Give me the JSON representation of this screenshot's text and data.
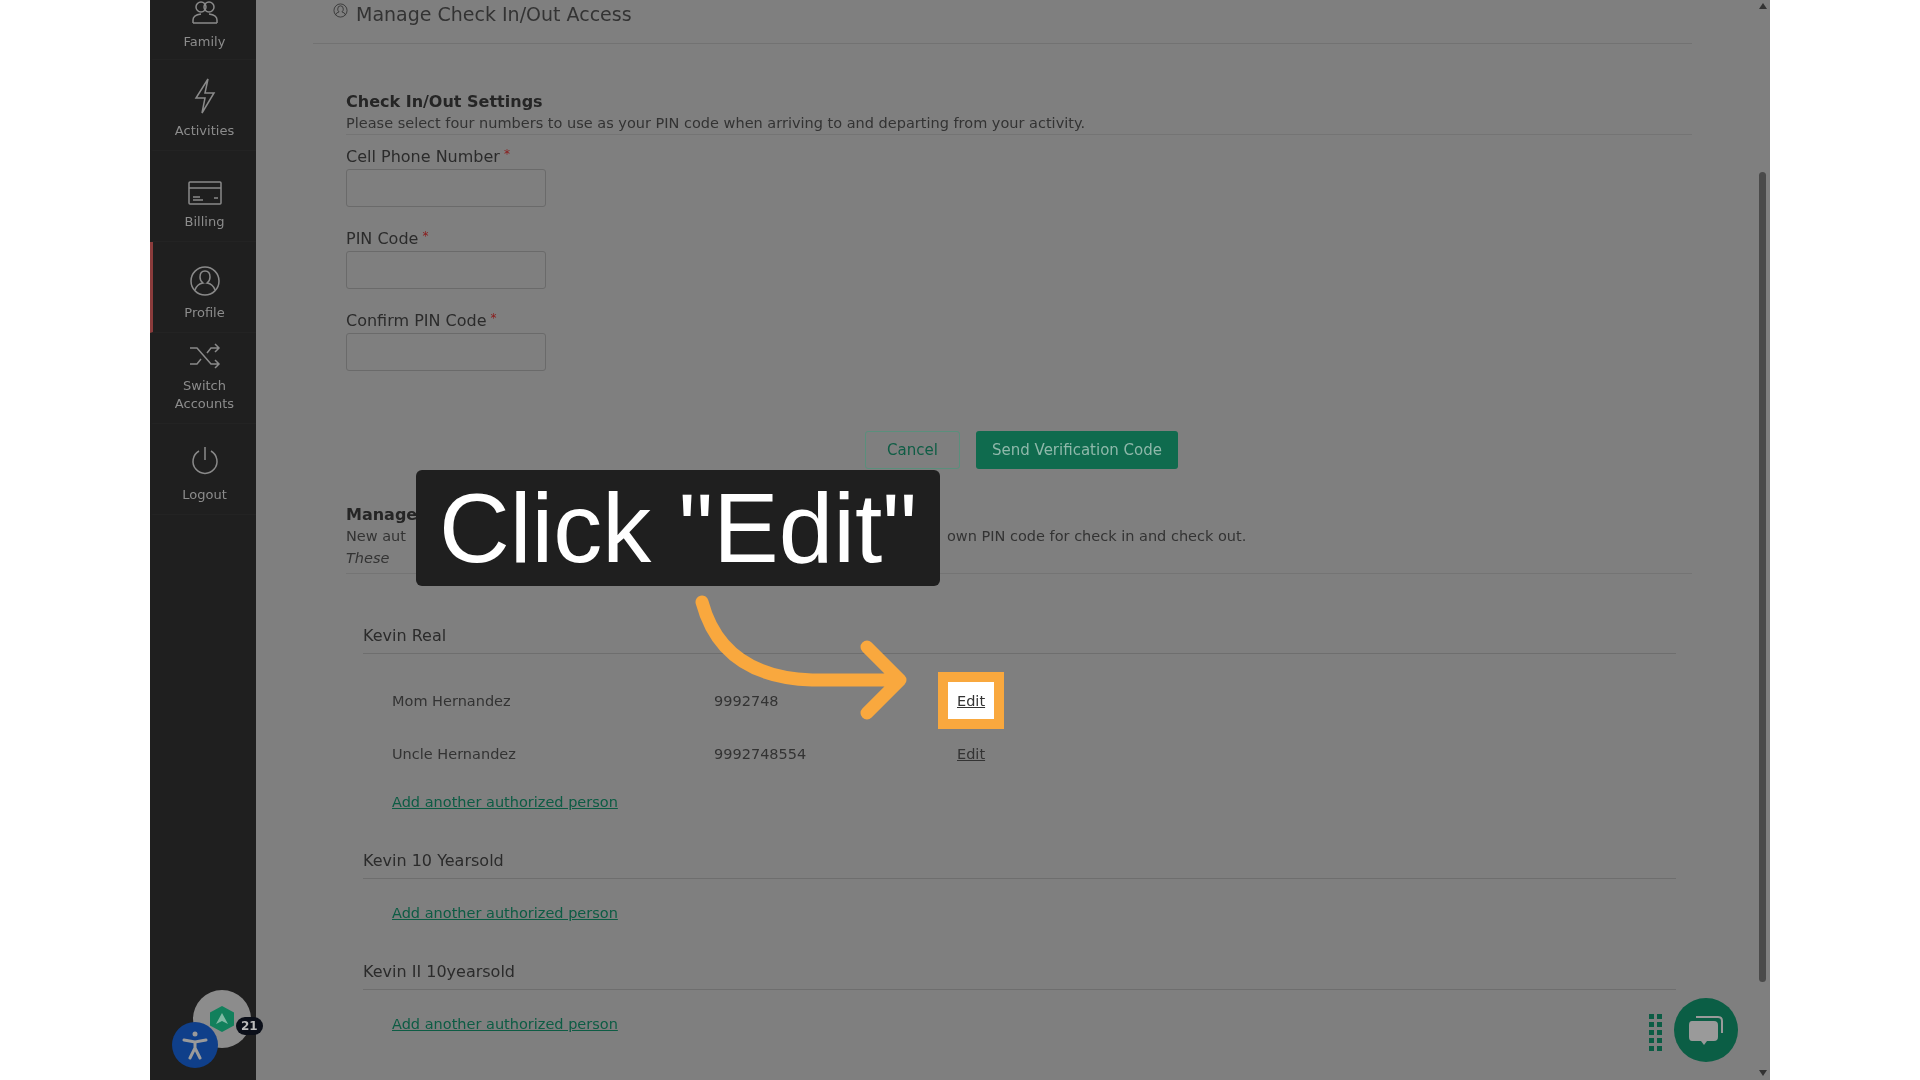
{
  "sidebar": {
    "items": [
      {
        "label": "Family",
        "kind": "family",
        "selected": false
      },
      {
        "label": "Activities",
        "kind": "bolt",
        "selected": false
      },
      {
        "label": "Billing",
        "kind": "card",
        "selected": false
      },
      {
        "label": "Profile",
        "kind": "person",
        "selected": true
      },
      {
        "label": "Switch Accounts",
        "kind": "shuffle",
        "selected": false
      },
      {
        "label": "Logout",
        "kind": "power",
        "selected": false
      }
    ],
    "notification_count": "21"
  },
  "header": {
    "title": "Manage Check In/Out Access"
  },
  "settings": {
    "title": "Check In/Out Settings",
    "description": "Please select four numbers to use as your PIN code when arriving to and departing from your activity.",
    "fields": [
      {
        "label": "Cell Phone Number",
        "mark": "*"
      },
      {
        "label": "PIN Code",
        "mark": "*"
      },
      {
        "label": "Confirm PIN Code",
        "mark": "*"
      }
    ],
    "cancel": "Cancel",
    "submit": "Send Verification Code"
  },
  "authorized": {
    "title": "Manage",
    "description_start": "New aut",
    "description_end": "own PIN code for check in and check out.",
    "note": "These",
    "groups": [
      {
        "name": "Kevin Real",
        "people": [
          {
            "name": "Mom Hernandez",
            "phone": "9992748",
            "action": "Edit",
            "highlighted": true
          },
          {
            "name": "Uncle Hernandez",
            "phone": "9992748554",
            "action": "Edit",
            "highlighted": false
          }
        ],
        "add_link": "Add another authorized person"
      },
      {
        "name": "Kevin 10 Yearsold",
        "add_link": "Add another authorized person"
      },
      {
        "name": "Kevin II 10yearsold",
        "add_link": "Add another authorized person"
      }
    ]
  },
  "callout": {
    "text": "Click \"Edit\""
  }
}
